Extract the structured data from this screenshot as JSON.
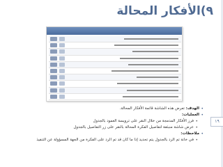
{
  "slide": {
    "title": "٩)الأفكار المحالة",
    "page_number": "١٩"
  },
  "screenshot": {
    "rows": 10
  },
  "content": {
    "goal_label": "الهدف:",
    "goal_text": "تعرض هذه الشاشة قائمة الأفكار المحالة.",
    "operations_label": "العمليات:",
    "op1": "فرز الأفكار المدمجة من خلال النقر على ترويسة العمود بالجدول",
    "op2": "عرض شاشة منبثقة لتفاصيل الفكرة المحالة بالنقر على زر التفاصيل بالجدول",
    "notes_label": "ملاحظات:",
    "note1": "في خانة تم الرد بالجدول يتم تحديد إذا ما كان قد تم الرد على الفكرة من الجهة المسؤولة عن التنفيذ"
  },
  "colors": {
    "title": "#4f6a92",
    "header": "#4a6b9c"
  }
}
